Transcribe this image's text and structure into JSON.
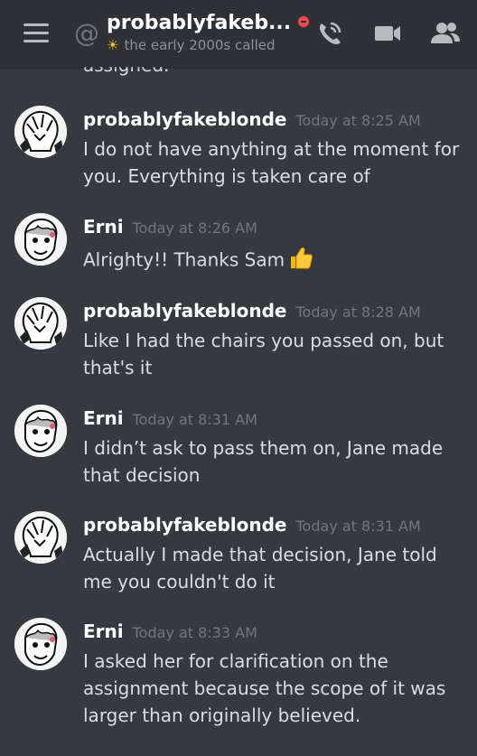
{
  "header": {
    "channel_name": "probablyfakeb...",
    "status_text": "the early 2000s called",
    "icons": {
      "menu": "hamburger-menu-icon",
      "at": "at-icon",
      "status": "dnd-status-icon",
      "sun": "sun-emoji-icon",
      "call": "phone-call-icon",
      "video": "video-camera-icon",
      "members": "members-icon"
    }
  },
  "cutoff_text": "assigned.",
  "messages": [
    {
      "author": "probablyfakeblonde",
      "time": "Today at 8:25 AM",
      "text": "I do not have anything at the moment for you. Everything is taken care of",
      "avatar": "blonde-avatar"
    },
    {
      "author": "Erni",
      "time": "Today at 8:26 AM",
      "text": "Alrighty!! Thanks Sam",
      "emoji": "thumbs-up-emoji",
      "avatar": "erni-avatar"
    },
    {
      "author": "probablyfakeblonde",
      "time": "Today at 8:28 AM",
      "text": "Like I had the chairs you passed on, but that's it",
      "avatar": "blonde-avatar"
    },
    {
      "author": "Erni",
      "time": "Today at 8:31 AM",
      "text": "I didn’t ask to pass them on, Jane made that decision",
      "avatar": "erni-avatar"
    },
    {
      "author": "probablyfakeblonde",
      "time": "Today at 8:31 AM",
      "text": "Actually I made that decision, Jane told me you couldn't do it",
      "avatar": "blonde-avatar"
    },
    {
      "author": "Erni",
      "time": "Today at 8:33 AM",
      "text": "I asked her for clarification on the assignment because the scope of it was larger than originally believed.",
      "avatar": "erni-avatar"
    }
  ],
  "colors": {
    "background": "#36393f",
    "header_background": "#2f3136",
    "author": "#ffffff",
    "timestamp": "#72767d",
    "message_text": "#dcddde",
    "dnd_red": "#f04747"
  }
}
